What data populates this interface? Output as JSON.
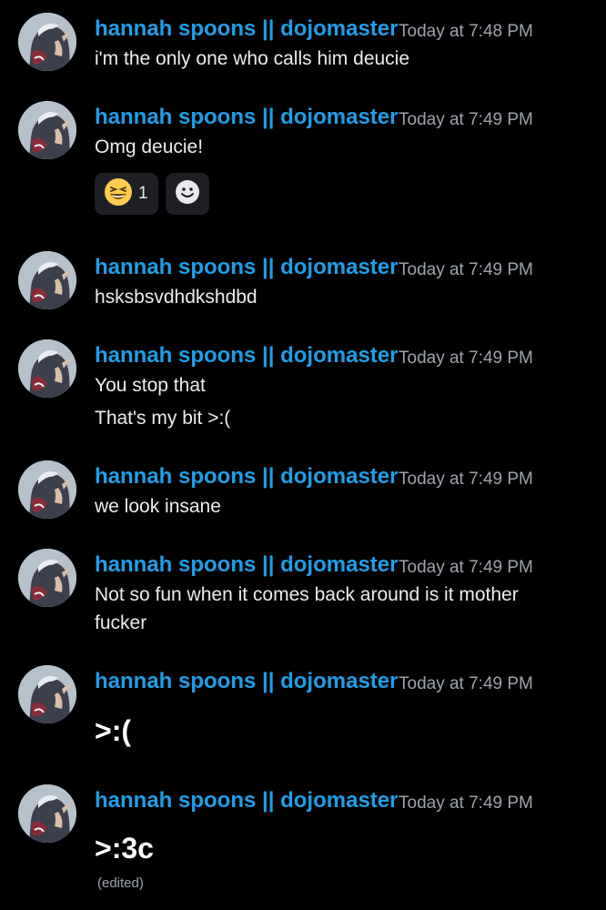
{
  "messages": [
    {
      "author": "hannah spoons || dojomaster",
      "timestamp": "Today at 7:48 PM",
      "lines": [
        "i'm the only one who calls him deucie"
      ]
    },
    {
      "author": "hannah spoons || dojomaster",
      "timestamp": "Today at 7:49 PM",
      "lines": [
        "Omg deucie!"
      ],
      "reactions": [
        {
          "icon": "laughing-emoji",
          "count": "1"
        },
        {
          "icon": "add-reaction-smiley-icon"
        }
      ]
    },
    {
      "author": "hannah spoons || dojomaster",
      "timestamp": "Today at 7:49 PM",
      "lines": [
        "hsksbsvdhdkshdbd"
      ]
    },
    {
      "author": "hannah spoons || dojomaster",
      "timestamp": "Today at 7:49 PM",
      "lines": [
        "You stop that",
        "That's my bit >:("
      ]
    },
    {
      "author": "hannah spoons || dojomaster",
      "timestamp": "Today at 7:49 PM",
      "lines": [
        "we look insane"
      ]
    },
    {
      "author": "hannah spoons || dojomaster",
      "timestamp": "Today at 7:49 PM",
      "lines": [
        "Not so fun when it comes back around is it mother fucker"
      ]
    },
    {
      "author": "hannah spoons || dojomaster",
      "timestamp": "Today at 7:49 PM",
      "lines": [
        ">:("
      ]
    },
    {
      "author": "hannah spoons || dojomaster",
      "timestamp": "Today at 7:49 PM",
      "lines": [
        ">:3c"
      ],
      "edited": "(edited)"
    }
  ],
  "colors": {
    "background": "#000000",
    "author": "#1f9ee6",
    "timestamp": "#9da3ad",
    "reaction_bg": "#1e1f24"
  }
}
